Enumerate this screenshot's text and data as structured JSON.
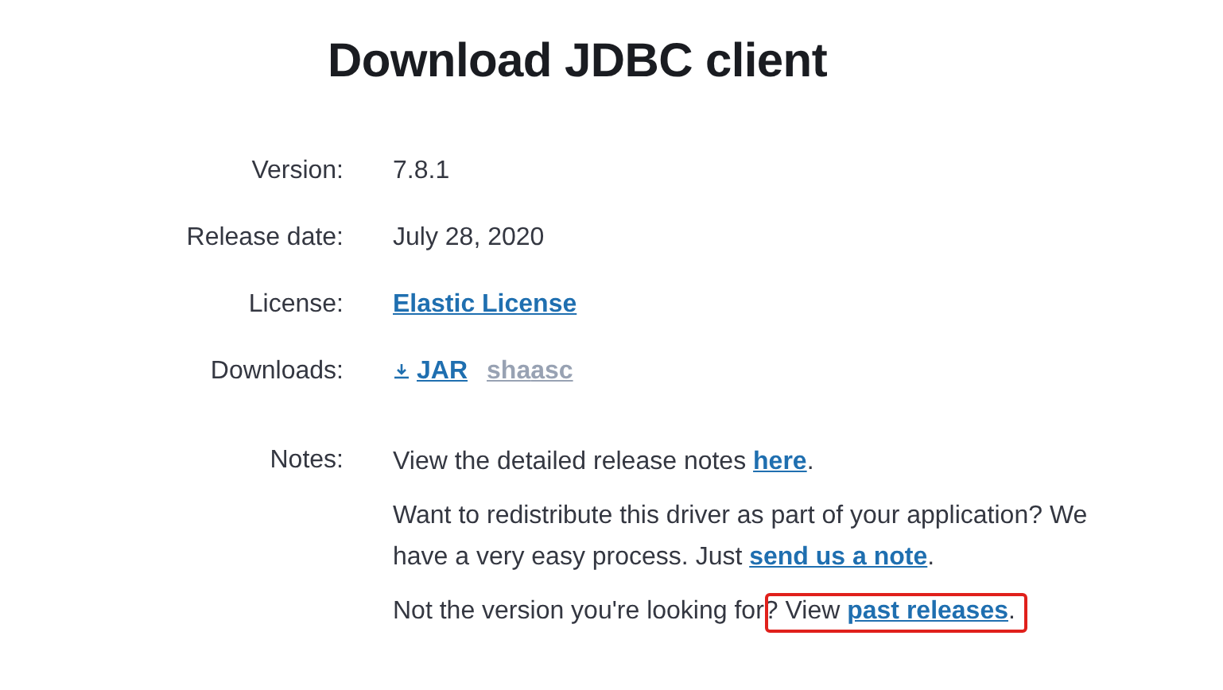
{
  "title": "Download JDBC client",
  "fields": [
    {
      "label": "Version:",
      "kind": "text",
      "value": "7.8.1"
    },
    {
      "label": "Release date:",
      "kind": "text",
      "value": "July 28, 2020"
    },
    {
      "label": "License:",
      "kind": "link",
      "value": "Elastic License"
    },
    {
      "label": "Downloads:",
      "kind": "downloads",
      "downloads": [
        {
          "text": "JAR",
          "kind": "file"
        },
        {
          "text": "sha",
          "kind": "checksum"
        },
        {
          "text": "asc",
          "kind": "checksum"
        }
      ]
    }
  ],
  "notes": {
    "label": "Notes:",
    "paragraphs": [
      [
        {
          "text": "View the detailed release notes ",
          "link": false,
          "highlighted": false
        },
        {
          "text": "here",
          "link": true,
          "highlighted": false
        },
        {
          "text": ".",
          "link": false,
          "highlighted": false
        }
      ],
      [
        {
          "text": "Want to redistribute this driver as part of your application? We have a very easy process. Just ",
          "link": false,
          "highlighted": false
        },
        {
          "text": "send us a note",
          "link": true,
          "highlighted": false
        },
        {
          "text": ".",
          "link": false,
          "highlighted": false
        }
      ],
      [
        {
          "text": "Not the version you're looking for",
          "link": false,
          "highlighted": false
        },
        {
          "text": "? View ",
          "link": false,
          "highlighted": true
        },
        {
          "text": "past releases",
          "link": true,
          "highlighted": true
        },
        {
          "text": ".",
          "link": false,
          "highlighted": true
        }
      ]
    ]
  }
}
